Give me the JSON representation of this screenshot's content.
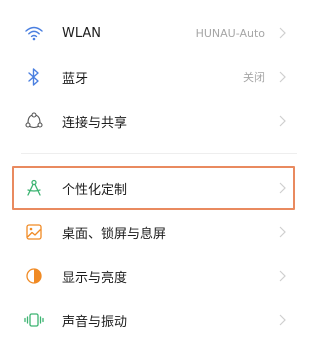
{
  "settings": {
    "items": [
      {
        "label": "WLAN",
        "value": "HUNAU-Auto",
        "icon": "wifi-icon"
      },
      {
        "label": "蓝牙",
        "value": "关闭",
        "icon": "bluetooth-icon"
      },
      {
        "label": "连接与共享",
        "value": "",
        "icon": "connection-share-icon"
      },
      {
        "label": "个性化定制",
        "value": "",
        "icon": "personalization-icon"
      },
      {
        "label": "桌面、锁屏与息屏",
        "value": "",
        "icon": "wallpaper-icon"
      },
      {
        "label": "显示与亮度",
        "value": "",
        "icon": "display-brightness-icon"
      },
      {
        "label": "声音与振动",
        "value": "",
        "icon": "sound-vibration-icon"
      }
    ]
  },
  "colors": {
    "highlight_border": "#e98a5f",
    "icon_blue": "#4a7fe0",
    "icon_orange": "#f08a24",
    "icon_green": "#3cb371",
    "chevron": "#cfcfcf"
  }
}
